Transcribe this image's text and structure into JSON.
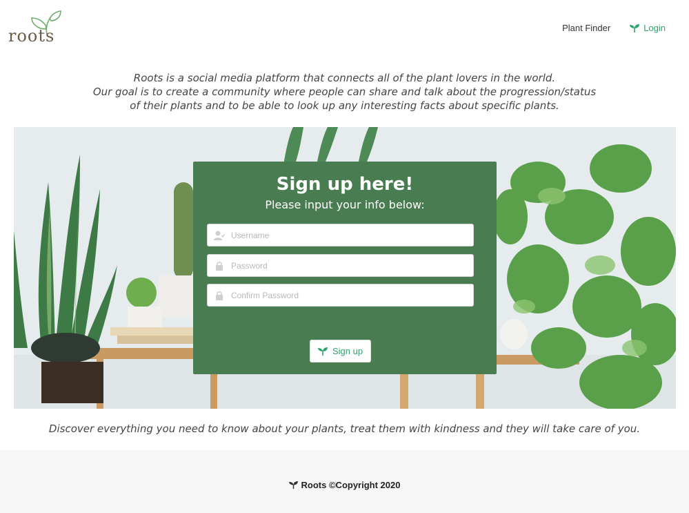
{
  "brand": {
    "logo_text": "roots"
  },
  "nav": {
    "plant_finder": "Plant Finder",
    "login": "Login"
  },
  "intro": {
    "line1": "Roots is a social media platform that connects all of the plant lovers in the world.",
    "line2": "Our goal is to create a community where people can share and talk about the progression/status",
    "line3": "of their plants and to be able to look up any interesting facts about specific plants."
  },
  "signup": {
    "title": "Sign up here!",
    "subtitle": "Please input your info below:",
    "username_placeholder": "Username",
    "password_placeholder": "Password",
    "confirm_placeholder": "Confirm Password",
    "button_label": "Sign up"
  },
  "tagline": "Discover everything you need to know about your plants, treat them with kindness and they will take care of you.",
  "footer": {
    "copyright": "Roots ©Copyright 2020"
  },
  "colors": {
    "accent": "#2fa36b",
    "card": "#4a7c52",
    "footer_bg": "#f7f7f7"
  },
  "icons": [
    "leaf-logo-icon",
    "sprout-icon",
    "user-icon",
    "lock-icon"
  ]
}
